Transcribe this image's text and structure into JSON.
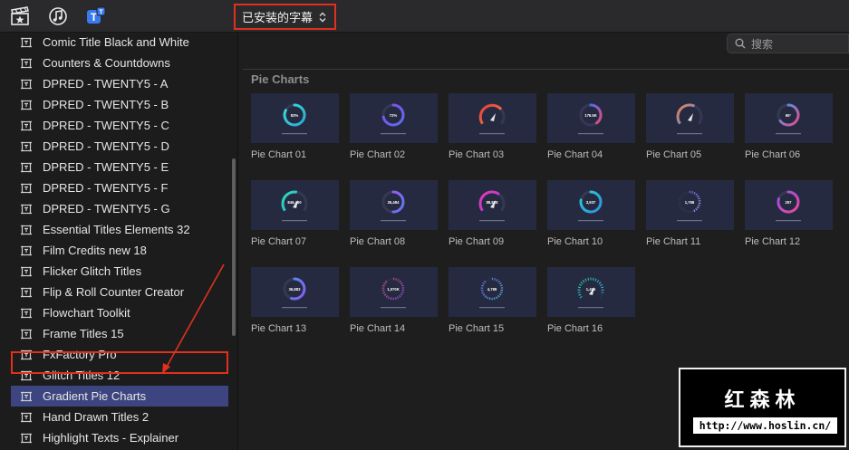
{
  "toolbar": {
    "icons": [
      "clapperboard-star-icon",
      "music-note-icon",
      "titles-icon"
    ],
    "dropdown_label": "已安装的字幕",
    "dropdown_chevron": "⌃⌄"
  },
  "search": {
    "placeholder": "搜索",
    "icon": "search-icon"
  },
  "sidebar": {
    "selected_color": "#3c4580",
    "items": [
      {
        "label": "Comic Title Black and White"
      },
      {
        "label": "Counters & Countdowns"
      },
      {
        "label": "DPRED - TWENTY5 - A"
      },
      {
        "label": "DPRED - TWENTY5 - B"
      },
      {
        "label": "DPRED - TWENTY5 - C"
      },
      {
        "label": "DPRED - TWENTY5 - D"
      },
      {
        "label": "DPRED - TWENTY5 - E"
      },
      {
        "label": "DPRED - TWENTY5 - F"
      },
      {
        "label": "DPRED - TWENTY5 - G"
      },
      {
        "label": "Essential Titles Elements 32"
      },
      {
        "label": "Film Credits new 18"
      },
      {
        "label": "Flicker Glitch Titles"
      },
      {
        "label": "Flip & Roll Counter Creator"
      },
      {
        "label": "Flowchart Toolkit"
      },
      {
        "label": "Frame Titles 15"
      },
      {
        "label": "FxFactory Pro"
      },
      {
        "label": "Glitch Titles 12"
      },
      {
        "label": "Gradient Pie Charts",
        "selected": true
      },
      {
        "label": "Hand Drawn Titles 2"
      },
      {
        "label": "Highlight Texts - Explainer"
      }
    ]
  },
  "section": {
    "title": "Pie Charts"
  },
  "thumbnails": [
    {
      "label": "Pie Chart 01",
      "value": "83%",
      "colors": [
        "#3be0d0",
        "#2aa8d8"
      ],
      "style": "ring",
      "fill": 0.83
    },
    {
      "label": "Pie Chart 02",
      "value": "72%",
      "colors": [
        "#8a4bf0",
        "#5b6cf0"
      ],
      "style": "ring",
      "fill": 0.72
    },
    {
      "label": "Pie Chart 03",
      "value": "",
      "colors": [
        "#e83a3a",
        "#f08a3a"
      ],
      "style": "gauge",
      "fill": 0.7
    },
    {
      "label": "Pie Chart 04",
      "value": "176.5K",
      "colors": [
        "#4a6cf0",
        "#e84a7a"
      ],
      "style": "ring",
      "fill": 0.4
    },
    {
      "label": "Pie Chart 05",
      "value": "",
      "colors": [
        "#f0804a",
        "#4a90f0"
      ],
      "style": "gauge",
      "fill": 0.6
    },
    {
      "label": "Pie Chart 06",
      "value": "65°",
      "colors": [
        "#3a9ef0",
        "#e84a8a"
      ],
      "style": "ring",
      "fill": 0.65
    },
    {
      "label": "Pie Chart 07",
      "value": "846,460",
      "colors": [
        "#2ae0b0",
        "#2ab0e0"
      ],
      "style": "gauge",
      "fill": 0.55
    },
    {
      "label": "Pie Chart 08",
      "value": "26,484",
      "colors": [
        "#9a5af0",
        "#5a7af0"
      ],
      "style": "ring",
      "fill": 0.5
    },
    {
      "label": "Pie Chart 09",
      "value": "88,888",
      "colors": [
        "#e83ab0",
        "#9a3ae8"
      ],
      "style": "gauge",
      "fill": 0.65
    },
    {
      "label": "Pie Chart 10",
      "value": "3,937",
      "colors": [
        "#2ad0d0",
        "#2a90e0"
      ],
      "style": "ring",
      "fill": 0.78
    },
    {
      "label": "Pie Chart 11",
      "value": "1,768",
      "colors": [
        "#6a6af0",
        "#b0b0ff"
      ],
      "style": "dots",
      "fill": 0.45
    },
    {
      "label": "Pie Chart 12",
      "value": "257",
      "colors": [
        "#9a4af0",
        "#e84a9a"
      ],
      "style": "ring",
      "fill": 0.8
    },
    {
      "label": "Pie Chart 13",
      "value": "36,883",
      "colors": [
        "#5a8af0",
        "#8a5af0"
      ],
      "style": "ring",
      "fill": 0.55
    },
    {
      "label": "Pie Chart 14",
      "value": "1,070K",
      "colors": [
        "#e84a6a",
        "#8a4af0"
      ],
      "style": "dots",
      "fill": 0.9
    },
    {
      "label": "Pie Chart 15",
      "value": "4,789",
      "colors": [
        "#6a6af0",
        "#4ac0e8"
      ],
      "style": "dots",
      "fill": 0.9
    },
    {
      "label": "Pie Chart 16",
      "value": "1,465",
      "colors": [
        "#2ad0b0",
        "#2ab0e0"
      ],
      "style": "gauge-dots",
      "fill": 0.9
    }
  ],
  "watermark": {
    "title": "红森林",
    "url": "http://www.hoslin.cn/"
  },
  "annotation": {
    "color": "#e0301e"
  }
}
